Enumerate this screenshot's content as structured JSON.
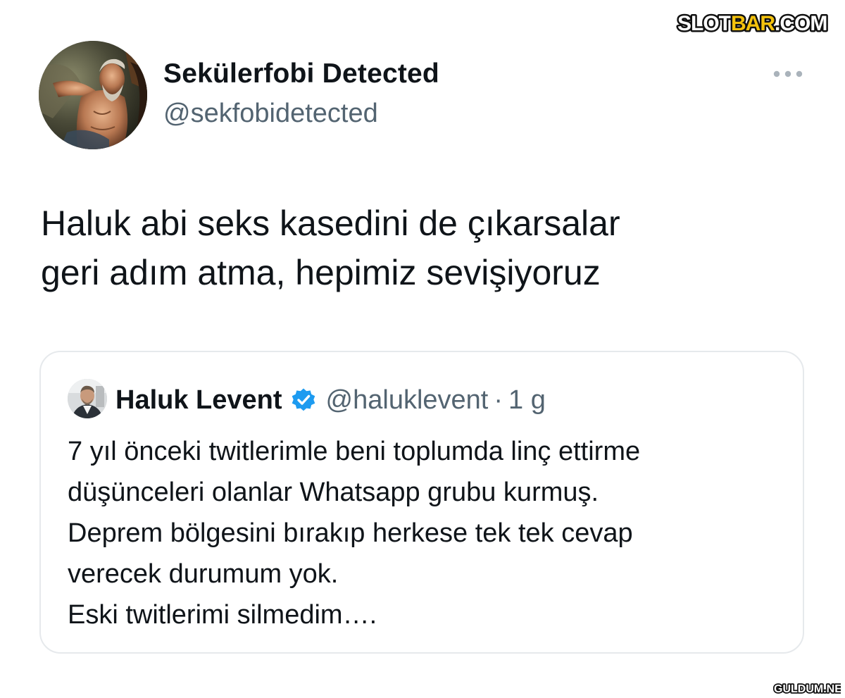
{
  "watermarks": {
    "top": "SLOTBAR.COM",
    "bottom": "GULDUM.NET"
  },
  "tweet": {
    "author": {
      "display_name": "Sekülerfobi Detected",
      "handle": "@sekfobidetected",
      "avatar_icon": "painting-avatar"
    },
    "more_icon": "more-options-icon",
    "text_lines": [
      "Haluk abi seks kasedini de çıkarsalar",
      "geri adım atma, hepimiz sevişiyoruz"
    ]
  },
  "quoted_tweet": {
    "author": {
      "display_name": "Haluk Levent",
      "handle": "@haluklevent",
      "verified": true,
      "avatar_icon": "profile-photo-avatar"
    },
    "separator": "·",
    "time": "1 g",
    "text_lines": [
      "7 yıl önceki twitlerimle beni toplumda linç ettirme",
      "düşünceleri olanlar Whatsapp grubu kurmuş.",
      "Deprem bölgesini bırakıp herkese tek tek cevap",
      "verecek durumum yok.",
      "Eski twitlerimi silmedim…."
    ]
  },
  "colors": {
    "text_primary": "#0f1419",
    "text_secondary": "#536471",
    "verified_blue": "#1d9bf0",
    "card_border": "#e6e9ec"
  }
}
